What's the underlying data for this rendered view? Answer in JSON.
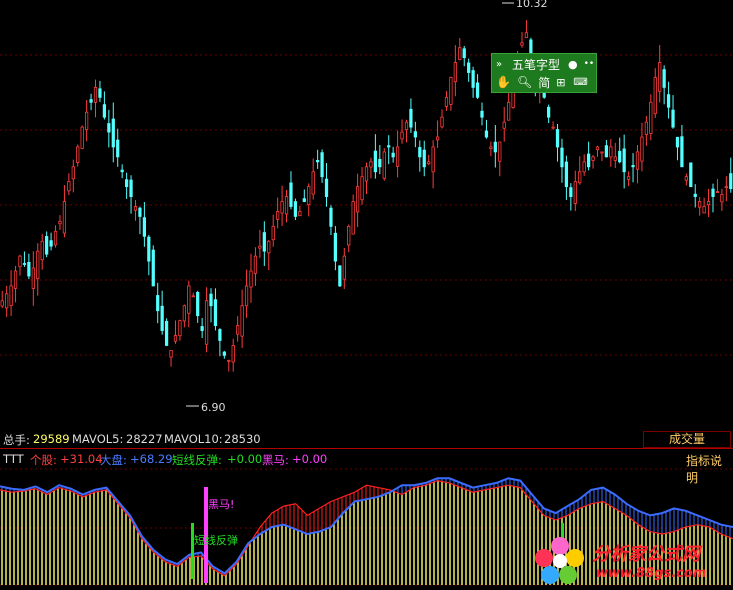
{
  "chart_data": {
    "type": "candlestick",
    "price_range": [
      6.5,
      10.5
    ],
    "up_color": "#ff3c3c",
    "down_color": "#54ffff",
    "high_label": "10.32",
    "low_label": "6.90",
    "closes": [
      7.55,
      7.62,
      7.7,
      7.85,
      8.0,
      7.92,
      7.8,
      7.88,
      8.05,
      8.15,
      8.02,
      8.1,
      8.25,
      8.35,
      8.55,
      8.75,
      8.9,
      9.1,
      9.3,
      9.45,
      9.55,
      9.7,
      9.6,
      9.4,
      9.25,
      9.1,
      9.0,
      8.85,
      8.7,
      8.6,
      8.5,
      8.4,
      8.2,
      7.95,
      7.7,
      7.45,
      7.25,
      7.1,
      7.05,
      7.2,
      7.35,
      7.5,
      7.7,
      7.6,
      7.4,
      7.25,
      7.55,
      7.5,
      7.3,
      7.15,
      7.0,
      6.95,
      7.1,
      7.3,
      7.5,
      7.7,
      7.85,
      8.0,
      8.1,
      8.05,
      8.15,
      8.3,
      8.45,
      8.55,
      8.6,
      8.5,
      8.4,
      8.45,
      8.55,
      8.7,
      8.85,
      8.95,
      8.8,
      8.6,
      8.3,
      7.95,
      7.7,
      8.0,
      8.3,
      8.55,
      8.7,
      8.8,
      8.9,
      8.95,
      8.85,
      8.9,
      9.05,
      9.1,
      9.0,
      9.1,
      9.25,
      9.35,
      9.3,
      9.2,
      9.0,
      8.9,
      8.95,
      9.1,
      9.2,
      9.4,
      9.6,
      9.8,
      9.95,
      10.1,
      10.0,
      9.85,
      9.7,
      9.6,
      9.4,
      9.2,
      9.1,
      9.05,
      9.15,
      9.35,
      9.55,
      9.8,
      10.0,
      10.15,
      10.25,
      9.9,
      9.7,
      9.8,
      9.6,
      9.4,
      9.3,
      9.1,
      8.9,
      8.7,
      8.6,
      8.75,
      8.85,
      8.95,
      8.9,
      9.0,
      9.1,
      9.05,
      9.0,
      9.1,
      9.0,
      8.95,
      8.85,
      8.8,
      8.9,
      9.05,
      9.2,
      9.35,
      9.55,
      9.8,
      9.95,
      9.7,
      9.5,
      9.3,
      9.1,
      8.9,
      8.8,
      8.7,
      8.6,
      8.55,
      8.5,
      8.55,
      8.6,
      8.65,
      8.62,
      8.7,
      8.68
    ]
  },
  "volume_bar": {
    "total_label": "总手:",
    "total_value": "29589",
    "mavol5_label": "MAVOL5:",
    "mavol5_value": "28227",
    "mavol10_label": "MAVOL10:",
    "mavol10_value": "28530",
    "dropdown_label": "成交量"
  },
  "indicator_bar": {
    "name": "TTT",
    "stock_label": "个股:",
    "stock_value": "+31.04",
    "market_label": "大盘:",
    "market_value": "+68.29",
    "short_label": "短线反弹:",
    "short_value": "+0.00",
    "horse_label": "黑马:",
    "horse_value": "+0.00",
    "help_label": "指标说明"
  },
  "annotations": {
    "black_horse": "黑马!",
    "short_rebound": "短线反弹"
  },
  "floating_toolbar": {
    "row1_label": "五笔字型",
    "row2_label": "简"
  },
  "logo": {
    "main": "分析家公式网",
    "url": "www.88gs.com"
  },
  "colors": {
    "up": "#ff3c3c",
    "down": "#54ffff",
    "yellow": "#ffff66",
    "blue_line": "#3a6cff",
    "red_line": "#ff2020",
    "magenta": "#ff40ff",
    "green": "#22dd22"
  }
}
